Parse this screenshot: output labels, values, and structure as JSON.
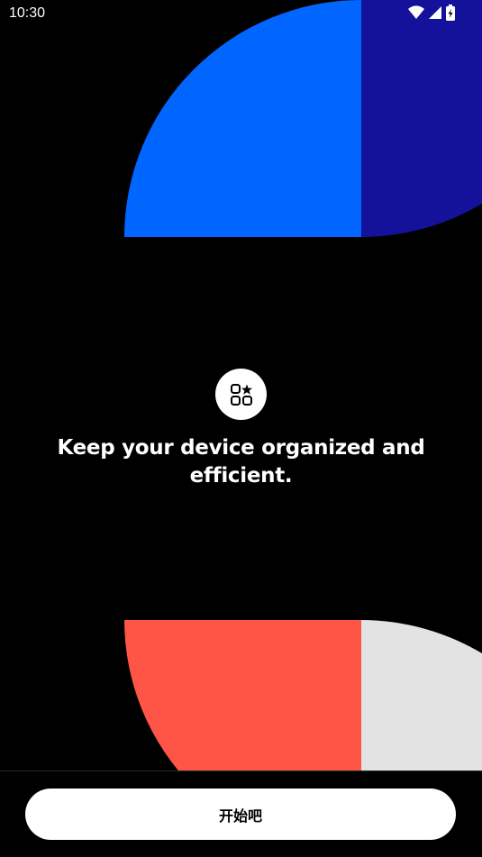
{
  "status_bar": {
    "time": "10:30",
    "icons": [
      "wifi-icon",
      "cellular-signal-icon",
      "battery-charging-icon"
    ]
  },
  "onboarding": {
    "icon": "apps-star-icon",
    "headline": "Keep your device organized and efficient.",
    "start_button_label": "开始吧"
  },
  "colors": {
    "background": "#000000",
    "shape_blue": "#0066FF",
    "shape_navy": "#14129A",
    "shape_red": "#FF5547",
    "shape_light_gray": "#E3E3E3",
    "button_bg": "#FFFFFF",
    "button_text": "#000000"
  }
}
